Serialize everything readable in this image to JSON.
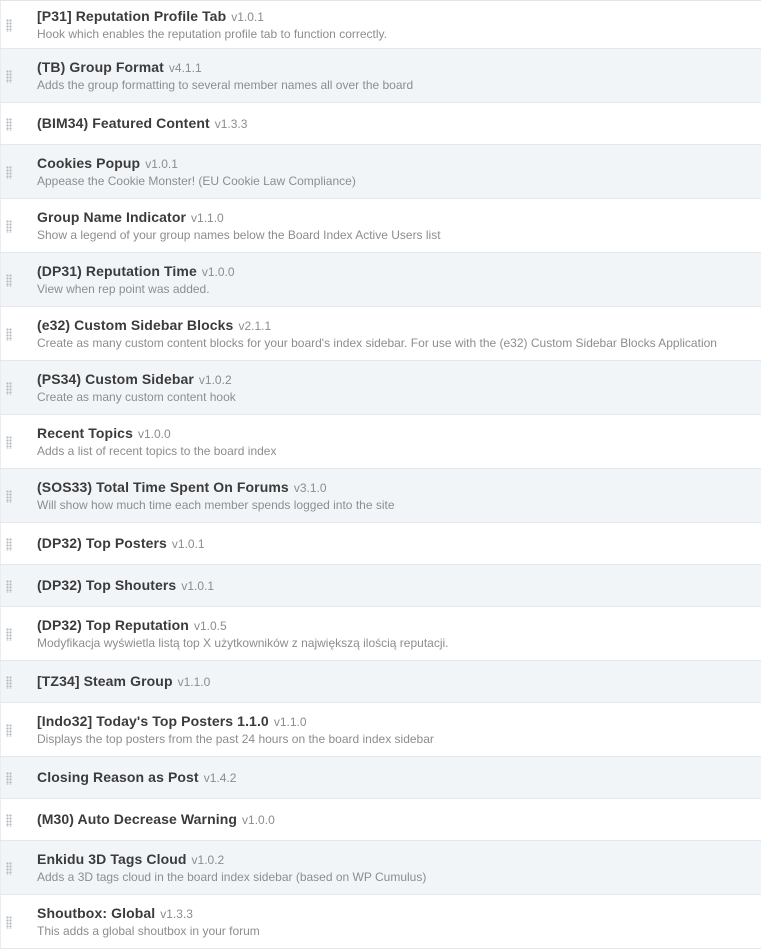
{
  "hooks": [
    {
      "title": "[P31] Reputation Profile Tab",
      "version": "v1.0.1",
      "description": "Hook which enables the reputation profile tab to function correctly."
    },
    {
      "title": "(TB) Group Format",
      "version": "v4.1.1",
      "description": "Adds the group formatting to several member names all over the board"
    },
    {
      "title": "(BIM34) Featured Content",
      "version": "v1.3.3",
      "description": ""
    },
    {
      "title": "Cookies Popup",
      "version": "v1.0.1",
      "description": "Appease the Cookie Monster! (EU Cookie Law Compliance)"
    },
    {
      "title": "Group Name Indicator",
      "version": "v1.1.0",
      "description": "Show a legend of your group names below the Board Index Active Users list"
    },
    {
      "title": "(DP31) Reputation Time",
      "version": "v1.0.0",
      "description": "View when rep point was added."
    },
    {
      "title": "(e32) Custom Sidebar Blocks",
      "version": "v2.1.1",
      "description": "Create as many custom content blocks for your board's index sidebar. For use with the (e32) Custom Sidebar Blocks Application"
    },
    {
      "title": "(PS34) Custom Sidebar",
      "version": "v1.0.2",
      "description": "Create as many custom content hook"
    },
    {
      "title": "Recent Topics",
      "version": "v1.0.0",
      "description": "Adds a list of recent topics to the board index"
    },
    {
      "title": "(SOS33) Total Time Spent On Forums",
      "version": "v3.1.0",
      "description": "Will show how much time each member spends logged into the site"
    },
    {
      "title": "(DP32) Top Posters",
      "version": "v1.0.1",
      "description": ""
    },
    {
      "title": "(DP32) Top Shouters",
      "version": "v1.0.1",
      "description": ""
    },
    {
      "title": "(DP32) Top Reputation",
      "version": "v1.0.5",
      "description": "Modyfikacja wyświetla listą top X użytkowników z największą ilością reputacji."
    },
    {
      "title": "[TZ34] Steam Group",
      "version": "v1.1.0",
      "description": ""
    },
    {
      "title": "[Indo32] Today's Top Posters 1.1.0",
      "version": "v1.1.0",
      "description": "Displays the top posters from the past 24 hours on the board index sidebar"
    },
    {
      "title": "Closing Reason as Post",
      "version": "v1.4.2",
      "description": ""
    },
    {
      "title": "(M30) Auto Decrease Warning",
      "version": "v1.0.0",
      "description": ""
    },
    {
      "title": "Enkidu 3D Tags Cloud",
      "version": "v1.0.2",
      "description": "Adds a 3D tags cloud in the board index sidebar (based on WP Cumulus)"
    },
    {
      "title": "Shoutbox: Global",
      "version": "v1.3.3",
      "description": "This adds a global shoutbox in your forum"
    }
  ]
}
